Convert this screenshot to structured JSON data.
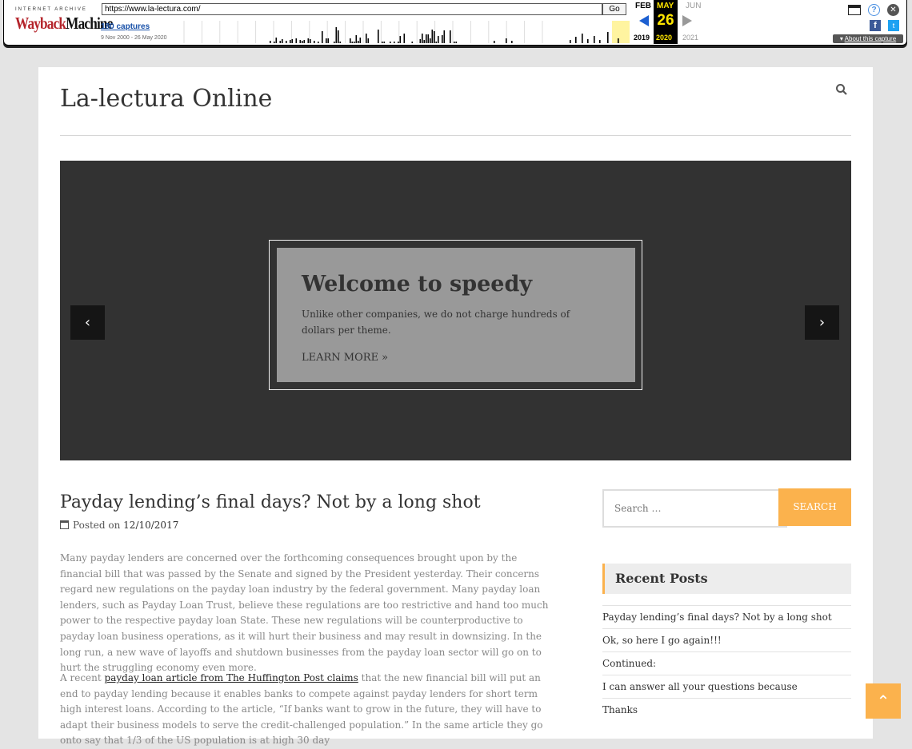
{
  "wayback": {
    "logo_top": "INTERNET ARCHIVE",
    "logo_way": "Wayback",
    "logo_machine": "Machine",
    "url": "https://www.la-lectura.com/",
    "go": "Go",
    "captures": "180 captures",
    "range": "9 Nov 2000 - 26 May 2020",
    "months": {
      "prev": "FEB",
      "cur": "MAY",
      "next": "JUN"
    },
    "day": "26",
    "years": {
      "prev": "2019",
      "cur": "2020",
      "next": "2021"
    },
    "about": "About this capture",
    "accent": "#ffe600"
  },
  "site": {
    "title": "La-lectura Online"
  },
  "slider": {
    "heading": "Welcome to speedy",
    "text": "Unlike other companies, we do not charge hundreds of dollars per theme.",
    "button": "LEARN MORE »",
    "prev": "‹",
    "next": "›"
  },
  "post": {
    "title": "Payday lending’s final days? Not by a long shot",
    "posted_label": "Posted on",
    "date": "12/10/2017",
    "p1": "Many payday lenders are concerned over the forthcoming consequences brought upon by the financial bill that was passed by the Senate and signed by the President yesterday. Their concerns regard new regulations on the payday loan industry by the federal government. Many payday loan lenders, such as Payday Loan Trust, believe these regulations are too restrictive and hand too much power to the respective payday loan State. These new regulations will be counterproductive to payday loan business operations, as it will hurt their business and may result in downsizing. In the long run, a new wave of layoffs and shutdown businesses from the payday loan sector will go on to hurt the struggling economy even more.",
    "p2_pre": "A recent ",
    "p2_link": "payday loan article from The Huffington Post claims",
    "p2_post": " that the new financial bill will put an end to payday lending because it enables banks to compete against payday lenders for short term high interest loans. According to the article, “If banks want to grow in the future, they will have to adapt their business models to serve the credit-challenged population.” In the same article they go onto say that 1/3 of the US population is at high 30 day"
  },
  "sidebar": {
    "search_placeholder": "Search …",
    "search_button": "SEARCH",
    "recent_title": "Recent Posts",
    "recent": [
      "Payday lending’s final days? Not by a long shot",
      "Ok, so here I go again!!!",
      "Continued:",
      "I can answer all your questions because",
      "Thanks"
    ],
    "accent": "#fbb24d"
  },
  "to_top": "⌃"
}
